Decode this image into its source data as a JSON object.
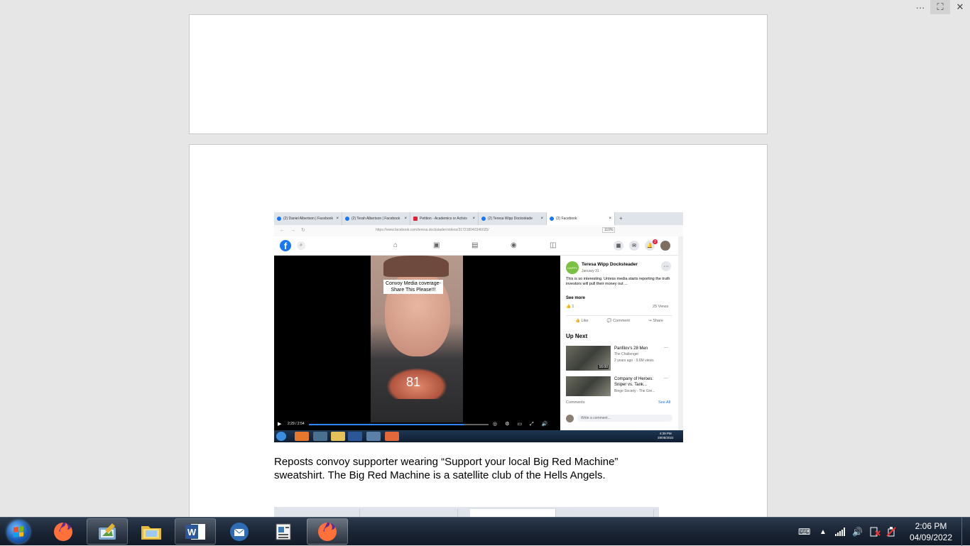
{
  "window_controls": {
    "more": "···",
    "fullscreen": "⛶",
    "close": "✕"
  },
  "embedded_screenshot": {
    "tabs": [
      {
        "label": "(2) Daniel Albertson | Facebook",
        "icon": "facebook-icon"
      },
      {
        "label": "(2) Terah Albertson | Facebook",
        "icon": "facebook-icon"
      },
      {
        "label": "Petition - Academics or Activis",
        "icon": "petition-icon"
      },
      {
        "label": "(2) Teresa Wipp Dockstéade",
        "icon": "facebook-icon"
      },
      {
        "label": "(2) Facebook",
        "icon": "facebook-icon",
        "active": true
      }
    ],
    "url": "https://www.facebook.com/teresa.dockstader/videos/317218040346025/",
    "zoom": "110%",
    "notification_badge": "2",
    "video": {
      "caption": "Convoy Media coverage-\nShare This Please!!!",
      "shirt_number": "81",
      "time": "2:29 / 2:54",
      "progress": 0.86
    },
    "post": {
      "author": "Teresa Wipp Docksteader",
      "avatar_text": "HAPPY",
      "date": "January 31 · ",
      "text": "This is so interesting. Unless media starts reporting the truth investors will pull their money out ...",
      "see_more": "See more",
      "likes": "1",
      "views": "25 Views",
      "like_label": "Like",
      "comment_label": "Comment",
      "share_label": "Share"
    },
    "up_next": {
      "title": "Up Next",
      "items": [
        {
          "title": "Panfilov's 28 Men",
          "channel": "The Challenger",
          "meta": "2 years ago · 9.6M views",
          "duration": "16:00"
        },
        {
          "title": "Company of Heroes: Sniper vs. Tank...",
          "channel": "Binge Society - The Gre...",
          "meta": "",
          "duration": ""
        }
      ]
    },
    "comments": {
      "label": "Comments",
      "see_all": "See All",
      "placeholder": "Write a comment..."
    },
    "taskbar_clock": {
      "time": "4:39 PM",
      "date": "28/08/2022"
    }
  },
  "caption_text": {
    "line1": "Reposts convoy supporter wearing “Support your local Big Red Machine”",
    "line2": "sweatshirt.  The Big Red Machine is a satellite club of the Hells Angels."
  },
  "taskbar": {
    "apps": [
      "firefox-icon",
      "paint-icon",
      "file-explorer-icon",
      "word-icon",
      "thunderbird-icon",
      "document-icon",
      "firefox-active-icon"
    ],
    "clock_time": "2:06 PM",
    "clock_date": "04/09/2022"
  },
  "colors": {
    "facebook_blue": "#1877f2",
    "taskbar": "#1a2535"
  }
}
